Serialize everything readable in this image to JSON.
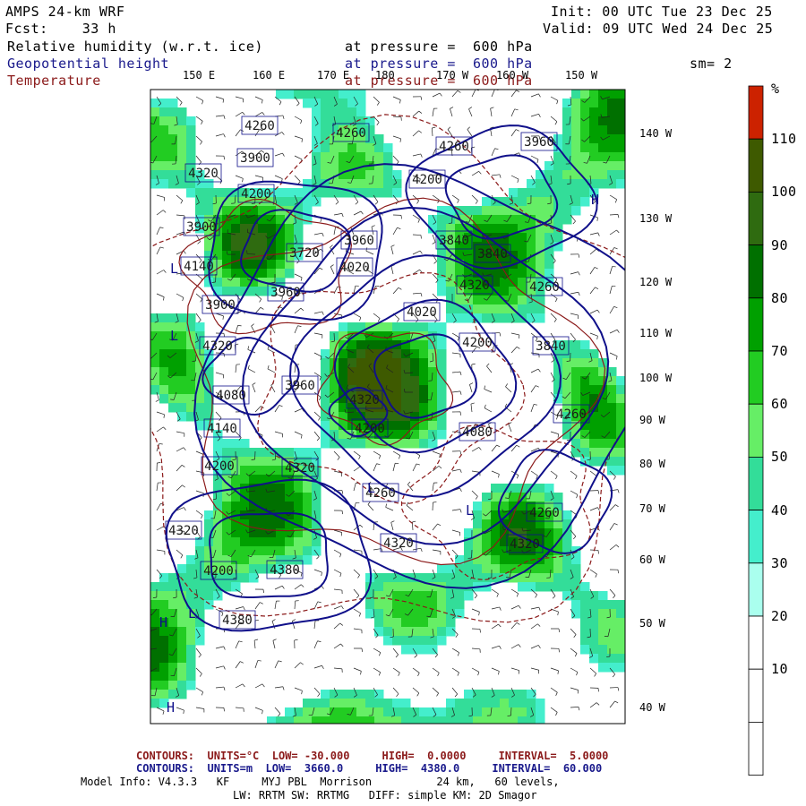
{
  "header": {
    "model": "AMPS 24-km WRF",
    "fcst_label": "Fcst:",
    "fcst_value": "33 h",
    "init_label": "Init:",
    "init_value": "00 UTC Tue 23 Dec 25",
    "valid_label": "Valid:",
    "valid_value": "09 UTC Wed 24 Dec 25"
  },
  "fields": [
    {
      "name": "Relative humidity (w.r.t. ice)",
      "level": "at pressure =  600 hPa",
      "color": "#000000"
    },
    {
      "name": "Geopotential height",
      "level": "at pressure =  600 hPa",
      "color": "#1a1a8c"
    },
    {
      "name": "Temperature",
      "level": "at pressure =  600 hPa",
      "color": "#8b1a1a"
    }
  ],
  "smoothing": "sm= 2",
  "top_lon_labels": [
    "150 E",
    "160 E",
    "170 E",
    "180",
    "170 W",
    "160 W",
    "150 W"
  ],
  "right_lon_labels": [
    "140 W",
    "130 W",
    "120 W",
    "110 W",
    "100 W",
    "90 W",
    "80 W",
    "70 W",
    "60 W",
    "50 W",
    "40 W"
  ],
  "colorbar": {
    "unit": "%",
    "labels": [
      "110",
      "100",
      "90",
      "80",
      "70",
      "60",
      "50",
      "40",
      "30",
      "20",
      "10"
    ],
    "colors": [
      "#cc2200",
      "#3e5a00",
      "#2f6b10",
      "#007000",
      "#00a000",
      "#22cc22",
      "#66ee66",
      "#33dd99",
      "#44eecc",
      "#aaffee",
      "#ffffff",
      "#ffffff",
      "#ffffff"
    ]
  },
  "height_labels": [
    "4260",
    "4260",
    "4260",
    "4320",
    "3960",
    "4200",
    "3900",
    "3720",
    "3900",
    "3960",
    "4200",
    "4020",
    "3840",
    "3840",
    "4140",
    "3960",
    "4260",
    "3900",
    "4320",
    "4020",
    "4200",
    "4320",
    "3840",
    "4080",
    "3960",
    "4320",
    "4260",
    "4200",
    "4140",
    "4080",
    "4200",
    "4320",
    "4260",
    "4260",
    "4320",
    "4320",
    "4200",
    "4380",
    "4320",
    "4380"
  ],
  "pressure_marks": [
    "H",
    "L",
    "L",
    "L",
    "L",
    "L",
    "H",
    "H"
  ],
  "footer": {
    "temp_contours": "CONTOURS:  UNITS=°C  LOW= -30.000     HIGH=  0.0000     INTERVAL=  5.0000",
    "height_contours": "CONTOURS:  UNITS=m  LOW=  3660.0     HIGH=  4380.0     INTERVAL=  60.000",
    "model_info": "Model Info: V4.3.3   KF     MYJ PBL  Morrison          24 km,   60 levels,",
    "model_info2": "LW: RRTM SW: RRTMG   DIFF: simple KM: 2D Smagor"
  }
}
